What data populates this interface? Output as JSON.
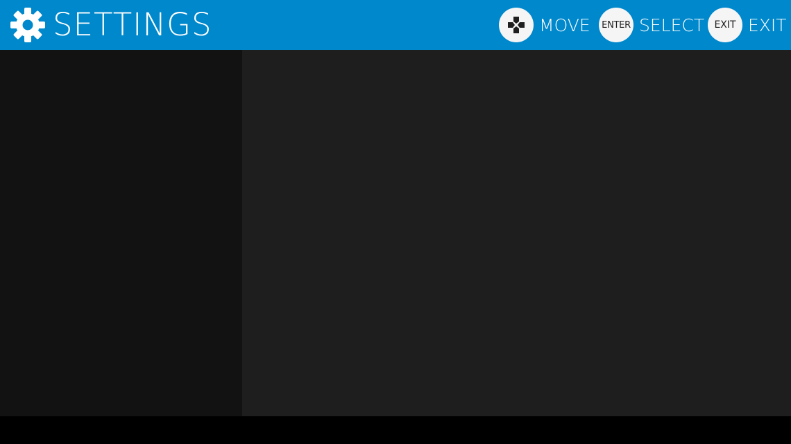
{
  "header": {
    "title": "SETTINGS",
    "title_icon": "gear-icon",
    "background_color": "#0088cc"
  },
  "hints": {
    "move": {
      "icon": "dpad-icon",
      "label": "MOVE"
    },
    "select": {
      "button_text": "ENTER",
      "label": "SELECT"
    },
    "exit": {
      "button_text": "EXIT",
      "label": "EXIT"
    }
  },
  "colors": {
    "sidebar": "#121212",
    "content": "#1e1e1e",
    "footer": "#000000"
  }
}
